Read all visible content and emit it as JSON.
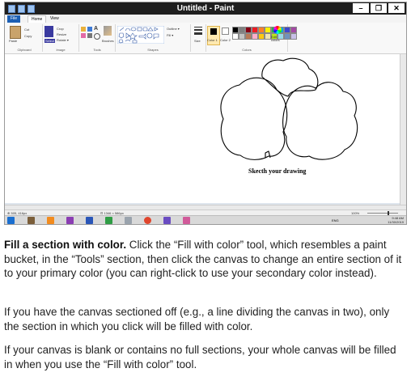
{
  "window": {
    "title": "Untitled - Paint",
    "controls": [
      "–",
      "❐",
      "✕"
    ]
  },
  "tabs": [
    "File",
    "Home",
    "View"
  ],
  "ribbon": {
    "clipboard": {
      "label": "Clipboard",
      "paste": "Paste",
      "cut": "Cut",
      "copy": "Copy"
    },
    "image": {
      "label": "Image",
      "select": "Select",
      "crop": "Crop",
      "resize": "Resize",
      "rotate": "Rotate ▾"
    },
    "tools": {
      "label": "Tools",
      "brushes": "Brushes"
    },
    "shapes": {
      "label": "Shapes",
      "outline": "Outline ▾",
      "fill": "Fill ▾"
    },
    "size": {
      "label": "Size"
    },
    "colors": {
      "label": "Colors",
      "color1": "Color 1",
      "color2": "Color 2",
      "edit": "Edit colors"
    },
    "palette": [
      "#000000",
      "#7f7f7f",
      "#880015",
      "#ed1c24",
      "#ff7f27",
      "#fff200",
      "#22b14c",
      "#00a2e8",
      "#3f48cc",
      "#a349a4",
      "#ffffff",
      "#c3c3c3",
      "#b97a57",
      "#ffaec9",
      "#ffc90e",
      "#efe4b0",
      "#b5e61d",
      "#99d9ea",
      "#7092be",
      "#c8bfe7"
    ]
  },
  "canvas": {
    "caption": "Skecth your drawing"
  },
  "status": {
    "pos": "⊕ 505, 416px",
    "size": "⊡ 1346 × 586px",
    "zoom": "100%"
  },
  "taskbar": {
    "time": "9:48 AM",
    "date": "11/30/2019",
    "lang": "ENG"
  },
  "article": {
    "p1_bold": "Fill a section with color.",
    "p1_rest": " Click the “Fill with color” tool, which resembles a paint bucket, in the “Tools” section, then click the canvas to change an entire section of it to your primary color (you can right-click to use your secondary color instead).",
    "p2": "If you have the canvas sectioned off (e.g., a line dividing the canvas in two), only the section in which you click will be filled with color.",
    "p3": "If your canvas is blank or contains no full sections, your whole canvas will be filled in when you use the “Fill with color” tool."
  }
}
